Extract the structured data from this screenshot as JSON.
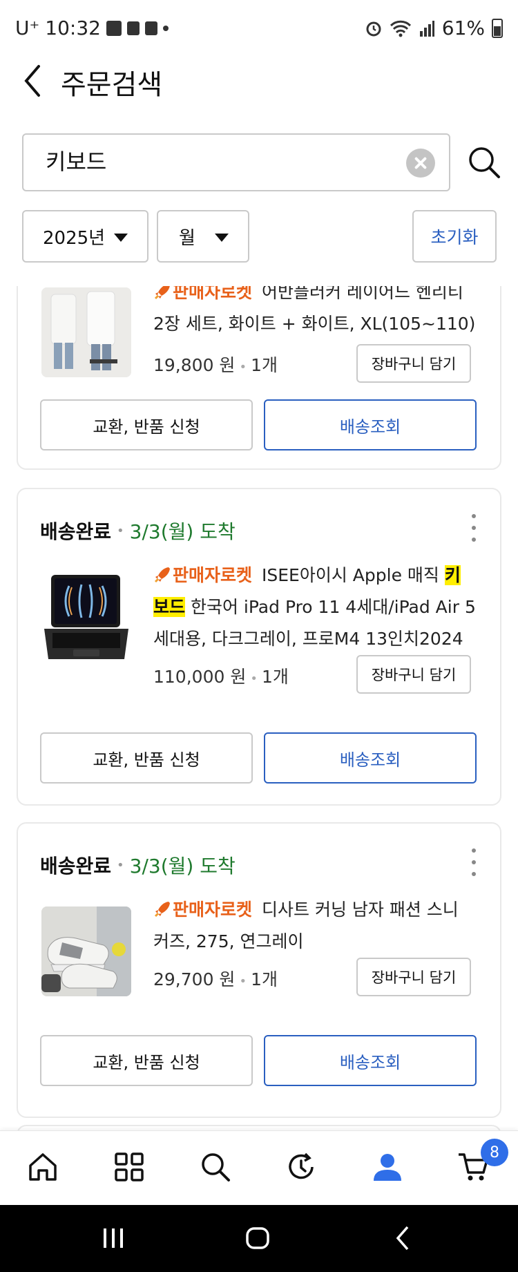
{
  "status_bar": {
    "carrier": "U⁺",
    "time": "10:32",
    "battery": "61%"
  },
  "header": {
    "title": "주문검색"
  },
  "search": {
    "query": "키보드"
  },
  "filters": {
    "year": "2025년",
    "month": "월",
    "reset_label": "초기화"
  },
  "orders": [
    {
      "brand": "판매자로켓",
      "title_line1": "어반플러커 레이어드 헨리티",
      "title_line2": "2장 세트, 화이트 + 화이트, XL(105~110)",
      "price": "19,800 원",
      "qty": "1개",
      "cart_label": "장바구니 담기",
      "exchange_label": "교환, 반품 신청",
      "track_label": "배송조회"
    },
    {
      "status": "배송완료",
      "arrival": "3/3(월) 도착",
      "brand": "판매자로켓",
      "title_pre": "ISEE아이시 Apple 매직 ",
      "highlight_1": "키",
      "highlight_2": "보드",
      "title_rest_1": " 한국어 iPad Pro 11 4세대/iPad Air 5",
      "title_rest_2": "세대용, 다크그레이, 프로M4 13인치2024",
      "price": "110,000 원",
      "qty": "1개",
      "cart_label": "장바구니 담기",
      "exchange_label": "교환, 반품 신청",
      "track_label": "배송조회"
    },
    {
      "status": "배송완료",
      "arrival": "3/3(월) 도착",
      "brand": "판매자로켓",
      "title_line1": "디사트 커닝 남자 패션 스니",
      "title_line2": "커즈, 275, 연그레이",
      "price": "29,700 원",
      "qty": "1개",
      "cart_label": "장바구니 담기",
      "exchange_label": "교환, 반품 신청",
      "track_label": "배송조회"
    }
  ],
  "bottom_nav": {
    "items": [
      "home-icon",
      "categories-icon",
      "search-icon",
      "recent-icon",
      "my-account-icon",
      "cart-icon"
    ],
    "cart_badge": "8"
  },
  "colors": {
    "accent_blue": "#2a5fc0",
    "rocket_orange": "#e8611a",
    "delivered_green": "#1f7a2e",
    "highlight_yellow": "#ffee00"
  }
}
